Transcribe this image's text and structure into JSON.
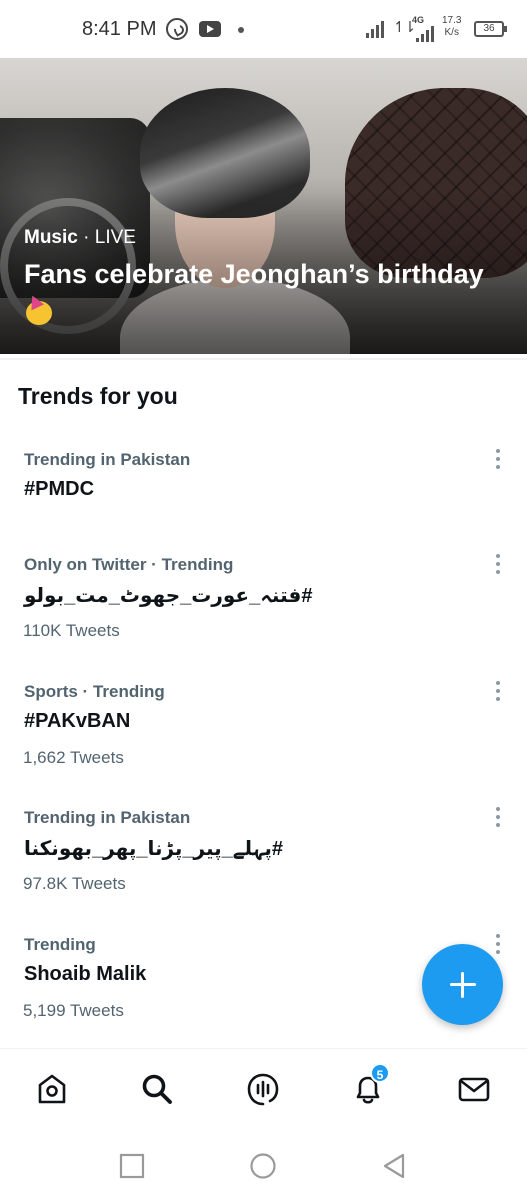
{
  "status_bar": {
    "time": "8:41 PM",
    "network_type": "4G",
    "speed_value": "17.3",
    "speed_unit": "K/s",
    "battery": "36"
  },
  "hero": {
    "category": "Music",
    "separator": " · ",
    "status": "LIVE",
    "title": "Fans celebrate Jeonghan’s birthday"
  },
  "trends": {
    "heading": "Trends for you",
    "items": [
      {
        "context": "Trending in Pakistan",
        "name": "#PMDC",
        "count": ""
      },
      {
        "context": "Only on Twitter · Trending",
        "name": "#فتنہ_عورت_جھوٹ_مت_بولو",
        "count": "110K Tweets"
      },
      {
        "context": "Sports · Trending",
        "name": "#PAKvBAN",
        "count": "1,662 Tweets"
      },
      {
        "context": "Trending in Pakistan",
        "name": "#پہلے_پیر_پڑنا_پھر_بھونکنا",
        "count": "97.8K Tweets"
      },
      {
        "context": "Trending",
        "name": "Shoaib Malik",
        "count": "5,199 Tweets"
      }
    ]
  },
  "fab": {
    "icon": "plus-icon"
  },
  "bottom_nav": {
    "items": [
      {
        "icon": "home-icon"
      },
      {
        "icon": "search-icon",
        "active": true
      },
      {
        "icon": "spaces-icon"
      },
      {
        "icon": "notifications-icon",
        "badge": "5"
      },
      {
        "icon": "messages-icon"
      }
    ]
  },
  "colors": {
    "accent": "#1d9bf0",
    "text_primary": "#0f1419",
    "text_secondary": "#536471"
  }
}
